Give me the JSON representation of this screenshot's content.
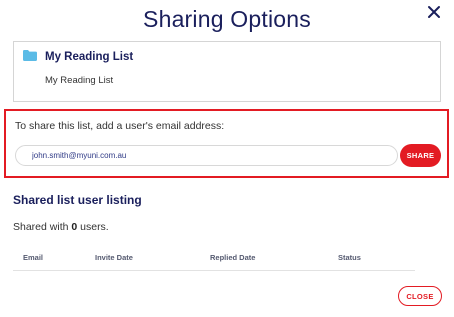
{
  "dialog": {
    "title": "Sharing Options"
  },
  "list": {
    "name": "My Reading List",
    "description": "My Reading List",
    "icon": "folder-icon"
  },
  "share": {
    "prompt": "To share this list, add a user's email address:",
    "email_value": "john.smith@myuni.com.au",
    "button_label": "SHARE"
  },
  "listing": {
    "title": "Shared list user listing",
    "shared_prefix": "Shared with ",
    "shared_count": "0",
    "shared_suffix": " users.",
    "columns": [
      "Email",
      "Invite Date",
      "Replied Date",
      "Status"
    ]
  },
  "footer": {
    "close_label": "CLOSE"
  },
  "colors": {
    "navy": "#1a1f5c",
    "accent_red": "#e31b23",
    "folder_blue": "#5bbbe6"
  }
}
